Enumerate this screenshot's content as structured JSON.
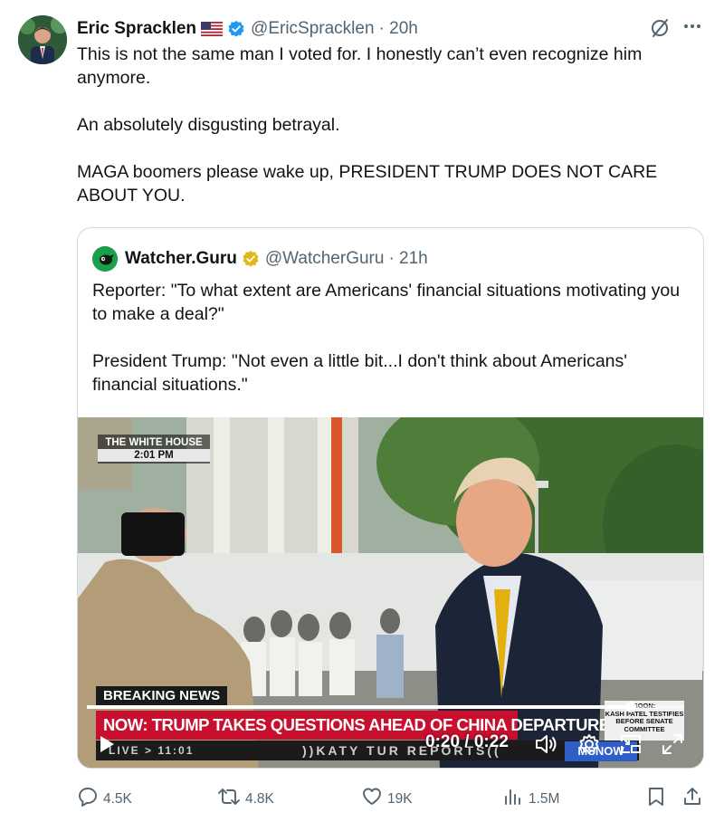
{
  "author": {
    "name": "Eric Spracklen",
    "handle": "@EricSpracklen",
    "time": "· 20h"
  },
  "tweet": {
    "lines": [
      "This is not the same man I voted for. I honestly can’t even recognize him anymore.",
      "",
      "An absolutely disgusting betrayal.",
      "",
      "MAGA boomers please wake up, PRESIDENT TRUMP DOES NOT CARE ABOUT YOU."
    ]
  },
  "quote": {
    "name": "Watcher.Guru",
    "handle": "@WatcherGuru",
    "time": "· 21h",
    "lines": [
      "Reporter: \"To what extent are Americans' financial situations motivating you to make a deal?\"",
      "",
      "President Trump: \"Not even a little bit...I don't think about Americans' financial situations.\""
    ]
  },
  "video": {
    "location_label": "THE WHITE HOUSE",
    "clock": "2:01 PM",
    "breaking": "BREAKING NEWS",
    "ticker": "NOW: TRUMP TAKES QUESTIONS AHEAD OF CHINA DEPARTURE",
    "live": "LIVE > 11:01",
    "show": "))KATY TUR REPORTS((",
    "soon_title": "SOON:",
    "soon_text": "KASH PATEL TESTIFIES BEFORE SENATE COMMITTEE",
    "network": "MSNOW",
    "time_readout": "0:20 / 0:22",
    "progress": 0.91
  },
  "actions": {
    "replies": "4.5K",
    "reposts": "4.8K",
    "likes": "19K",
    "views": "1.5M"
  },
  "icons": {
    "reply": "reply-icon",
    "repost": "repost-icon",
    "like": "heart-icon",
    "views": "views-icon",
    "bookmark": "bookmark-icon",
    "share": "share-icon"
  },
  "colors": {
    "verified_blue": "#1d9bf0",
    "gold_badge": "#e2b719",
    "muted": "#536471",
    "ticker_red": "#c8102e"
  }
}
